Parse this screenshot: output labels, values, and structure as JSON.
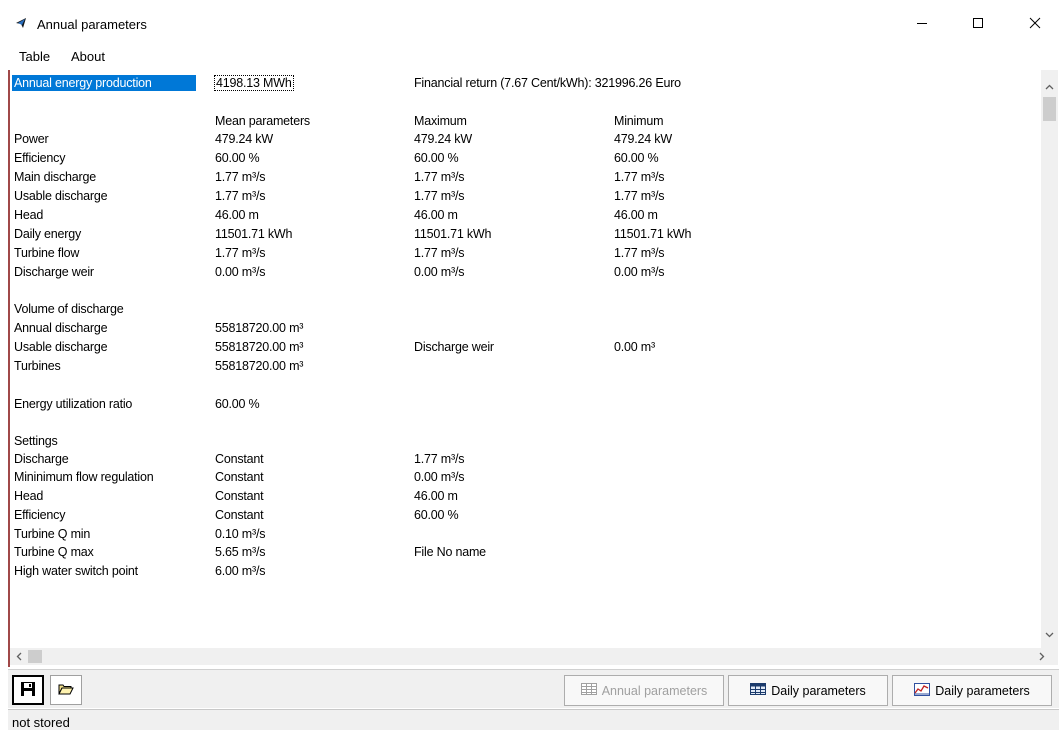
{
  "window": {
    "title": "Annual parameters"
  },
  "menu": {
    "items": [
      "Table",
      "About"
    ]
  },
  "summary": {
    "label": "Annual energy production",
    "value": "4198.13 MWh",
    "financial": "Financial return (7.67 Cent/kWh): 321996.26 Euro"
  },
  "params": {
    "headers": [
      "Mean parameters",
      "Maximum",
      "Minimum"
    ],
    "rows": [
      {
        "label": "Power",
        "mean": "479.24 kW",
        "max": "479.24 kW",
        "min": "479.24 kW"
      },
      {
        "label": "Efficiency",
        "mean": "60.00 %",
        "max": "60.00 %",
        "min": "60.00 %"
      },
      {
        "label": "Main discharge",
        "mean": "1.77 m³/s",
        "max": "1.77 m³/s",
        "min": "1.77 m³/s"
      },
      {
        "label": "Usable discharge",
        "mean": "1.77 m³/s",
        "max": "1.77 m³/s",
        "min": "1.77 m³/s"
      },
      {
        "label": "Head",
        "mean": "46.00 m",
        "max": "46.00 m",
        "min": "46.00 m"
      },
      {
        "label": "Daily energy",
        "mean": "11501.71 kWh",
        "max": "11501.71 kWh",
        "min": "11501.71 kWh"
      },
      {
        "label": "Turbine flow",
        "mean": "1.77 m³/s",
        "max": "1.77 m³/s",
        "min": "1.77 m³/s"
      },
      {
        "label": "Discharge weir",
        "mean": "0.00 m³/s",
        "max": "0.00 m³/s",
        "min": "0.00 m³/s"
      }
    ]
  },
  "volume": {
    "title": "Volume of discharge",
    "annual_label": "Annual discharge",
    "annual_value": "55818720.00 m³",
    "usable_label": "Usable discharge",
    "usable_value": "55818720.00 m³",
    "weir_label": "Discharge weir",
    "weir_value": "0.00 m³",
    "turbines_label": "Turbines",
    "turbines_value": "55818720.00 m³"
  },
  "ratio": {
    "label": "Energy utilization ratio",
    "value": "60.00 %"
  },
  "settings": {
    "title": "Settings",
    "rows": [
      {
        "label": "Discharge",
        "mode": "Constant",
        "value": "1.77 m³/s"
      },
      {
        "label": "Mininimum flow regulation",
        "mode": "Constant",
        "value": "0.00 m³/s"
      },
      {
        "label": "Head",
        "mode": "Constant",
        "value": "46.00 m"
      },
      {
        "label": "Efficiency",
        "mode": "Constant",
        "value": "60.00 %"
      },
      {
        "label": "Turbine Q min",
        "mode": "0.10 m³/s",
        "value": ""
      },
      {
        "label": "Turbine Q max",
        "mode": "5.65 m³/s",
        "value": "File No name"
      },
      {
        "label": "High water switch point",
        "mode": "6.00 m³/s",
        "value": ""
      }
    ]
  },
  "buttons": {
    "annual": "Annual parameters",
    "daily_table": "Daily parameters",
    "daily_chart": "Daily parameters"
  },
  "status": {
    "text": "not stored"
  },
  "colors": {
    "selection": "#0078d7",
    "left_border": "#a04848"
  }
}
